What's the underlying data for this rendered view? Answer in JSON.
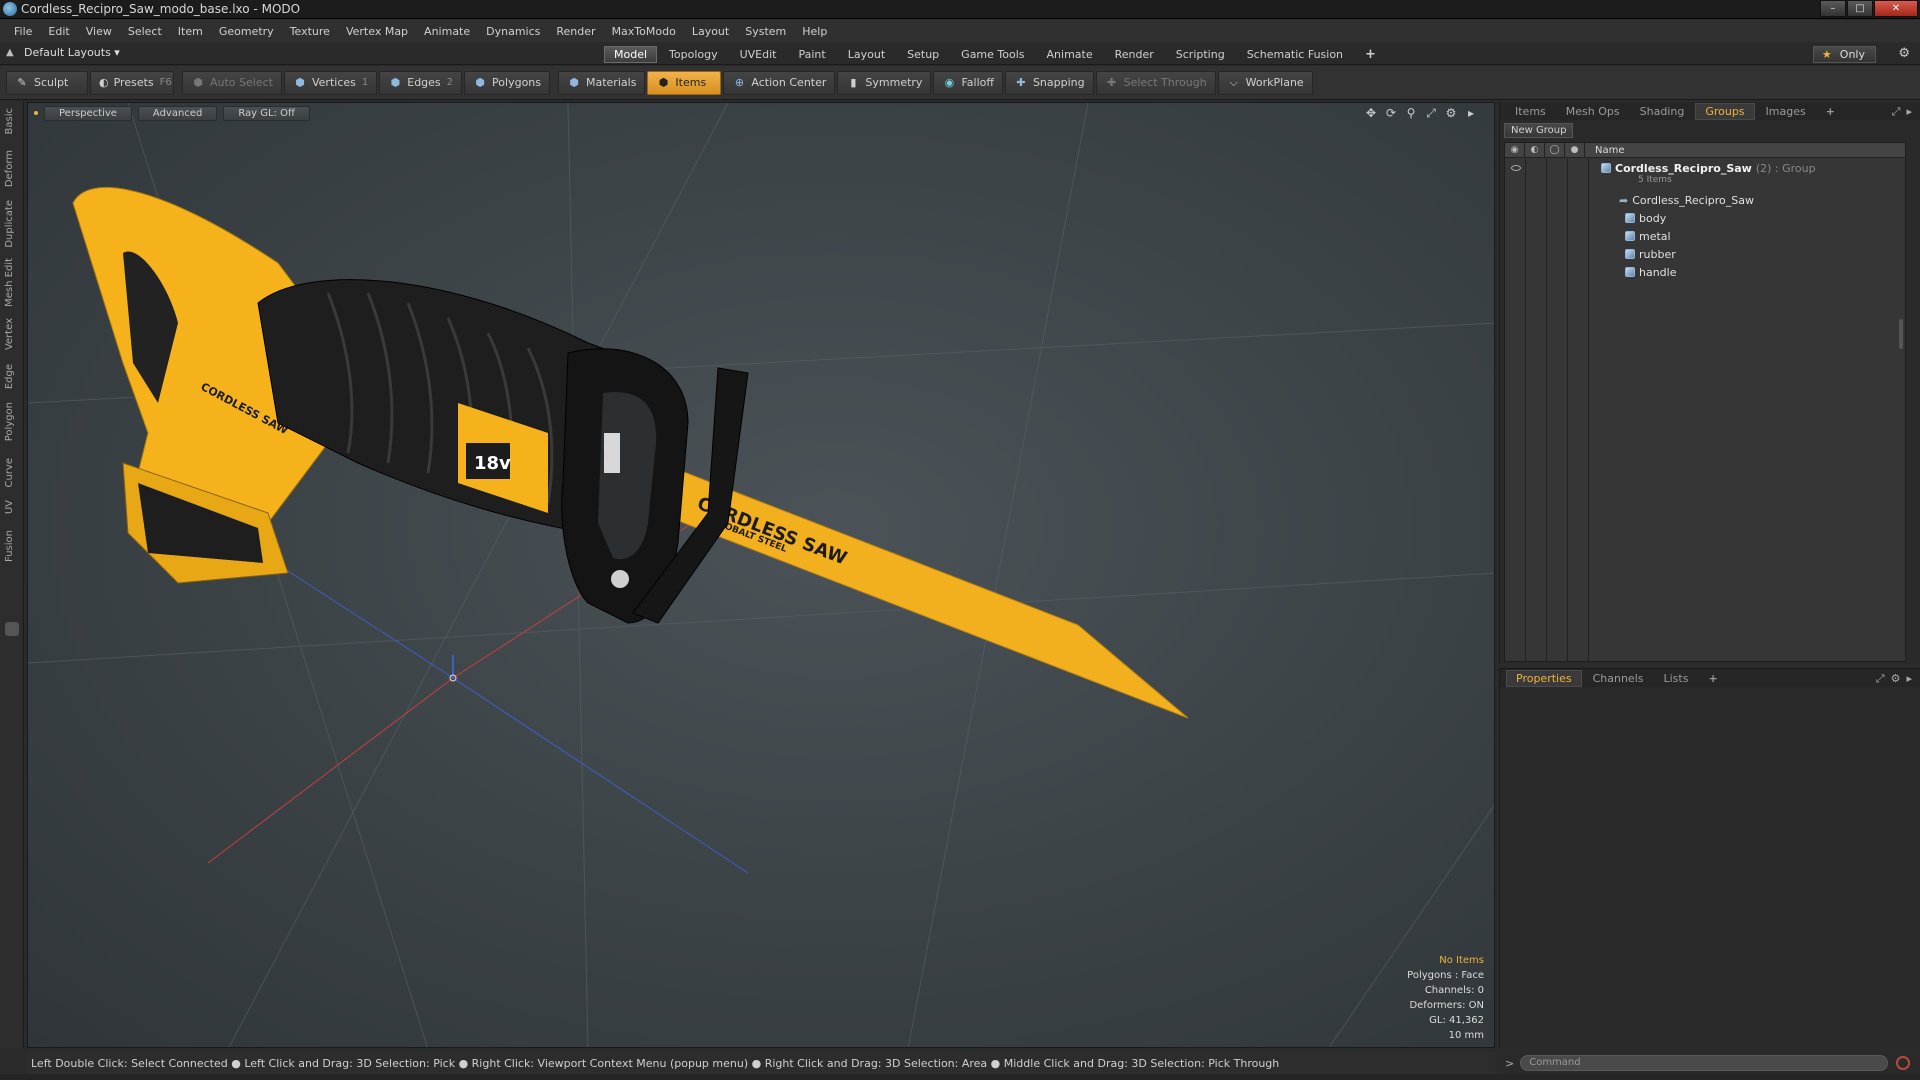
{
  "window": {
    "title": "Cordless_Recipro_Saw_modo_base.lxo - MODO",
    "controls": [
      "–",
      "□",
      "✕"
    ]
  },
  "menu": [
    "File",
    "Edit",
    "View",
    "Select",
    "Item",
    "Geometry",
    "Texture",
    "Vertex Map",
    "Animate",
    "Dynamics",
    "Render",
    "MaxToModo",
    "Layout",
    "System",
    "Help"
  ],
  "layout_bar": {
    "default_layouts": "Default Layouts ▾",
    "tabs": [
      "Model",
      "Topology",
      "UVEdit",
      "Paint",
      "Layout",
      "Setup",
      "Game Tools",
      "Animate",
      "Render",
      "Scripting",
      "Schematic Fusion"
    ],
    "active_tab": "Model",
    "add_tab": "+",
    "only_label": "Only"
  },
  "toolbar": {
    "sculpt": "Sculpt",
    "presets": "Presets",
    "presets_key": "F6",
    "auto_select": "Auto Select",
    "vertices": "Vertices",
    "vertices_count": "1",
    "edges": "Edges",
    "edges_count": "2",
    "polygons": "Polygons",
    "materials": "Materials",
    "items": "Items",
    "action_center": "Action Center",
    "symmetry": "Symmetry",
    "falloff": "Falloff",
    "snapping": "Snapping",
    "select_through": "Select Through",
    "workplane": "WorkPlane"
  },
  "left_tabs": [
    "Basic",
    "Deform",
    "Duplicate",
    "Mesh Edit",
    "Vertex",
    "Edge",
    "Polygon",
    "Curve",
    "UV",
    "Fusion"
  ],
  "viewport": {
    "view": "Perspective",
    "shading": "Advanced",
    "raygl": "Ray GL: Off",
    "info": {
      "no_items": "No Items",
      "polygons": "Polygons : Face",
      "channels": "Channels: 0",
      "deformers": "Deformers: ON",
      "gl": "GL: 41,362",
      "scale": "10 mm"
    },
    "model_text": {
      "blade_title": "CORDLESS SAW",
      "blade_sub": "COBALT STEEL",
      "voltage": "18v",
      "body_label": "CORDLESS SAW"
    }
  },
  "status": "Left Double Click: Select Connected ● Left Click and Drag: 3D Selection: Pick ● Right Click: Viewport Context Menu (popup menu) ● Right Click and Drag: 3D Selection: Area ● Middle Click and Drag: 3D Selection: Pick Through",
  "right_panel": {
    "tabs": [
      "Items",
      "Mesh Ops",
      "Shading",
      "Groups",
      "Images"
    ],
    "active_tab": "Groups",
    "add_tab": "+",
    "new_group": "New Group",
    "name_header": "Name",
    "group": {
      "name": "Cordless_Recipro_Saw",
      "extra": "(2) : Group",
      "count": "5 Items",
      "children": [
        "Cordless_Recipro_Saw",
        "body",
        "metal",
        "rubber",
        "handle"
      ]
    }
  },
  "properties_panel": {
    "tabs": [
      "Properties",
      "Channels",
      "Lists"
    ],
    "active_tab": "Properties",
    "add_tab": "+"
  },
  "command": {
    "prompt": ">",
    "placeholder": "Command"
  },
  "colors": {
    "accent": "#f0b43a",
    "saw_yellow": "#f5b21b",
    "saw_black": "#1c1c1c"
  }
}
